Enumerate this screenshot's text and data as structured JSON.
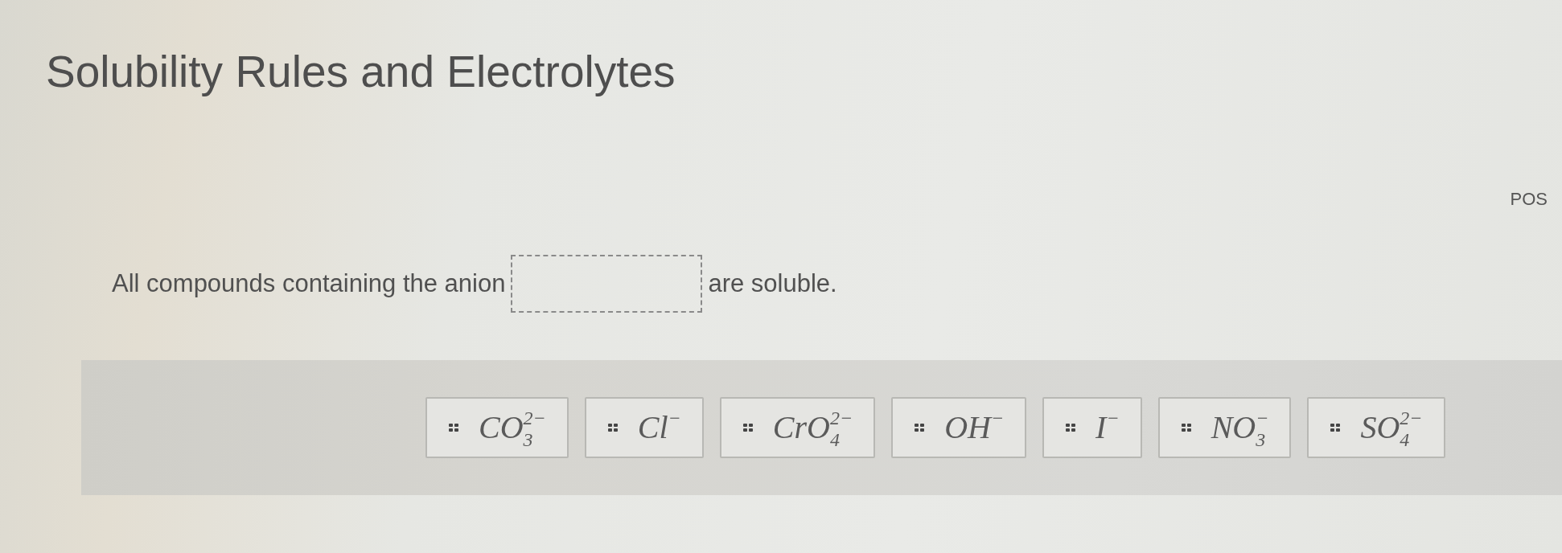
{
  "title": "Solubility Rules and Electrolytes",
  "side_label": "POS",
  "question": {
    "text_before": "All compounds containing the anion",
    "text_after": "are soluble."
  },
  "choices": [
    {
      "formula": "CO$_{3}$$^{2−}$"
    },
    {
      "formula": "Cl$^{−}$"
    },
    {
      "formula": "CrO$_{4}$$^{2−}$"
    },
    {
      "formula": "OH$^{−}$"
    },
    {
      "formula": "I$^{−}$"
    },
    {
      "formula": "NO$_{3}$$^{−}$"
    },
    {
      "formula": "SO$_{4}$$^{2−}$"
    }
  ]
}
